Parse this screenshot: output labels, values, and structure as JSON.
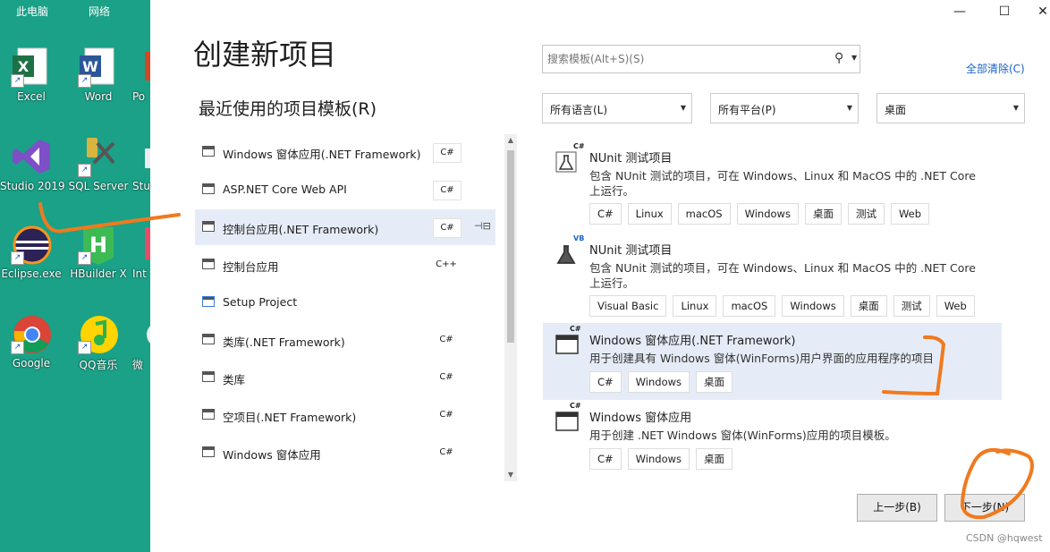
{
  "desktop": {
    "top_labels": [
      "此电脑",
      "网络"
    ],
    "icons": [
      {
        "label": "Excel",
        "icon": "excel-icon"
      },
      {
        "label": "Word",
        "icon": "word-icon"
      },
      {
        "label": "Po",
        "icon": "powerpoint-icon"
      },
      {
        "label": "Studio 2019",
        "icon": "visual-studio-icon"
      },
      {
        "label": "SQL Server",
        "icon": "sql-server-icon"
      },
      {
        "label": "Stu",
        "icon": "studio-icon"
      },
      {
        "label": "Eclipse.exe",
        "icon": "eclipse-icon"
      },
      {
        "label": "HBuilder X",
        "icon": "hbuilder-icon"
      },
      {
        "label": "Int",
        "icon": "intellij-icon"
      },
      {
        "label": "Google",
        "icon": "chrome-icon"
      },
      {
        "label": "QQ音乐",
        "icon": "qq-music-icon"
      },
      {
        "label": "微",
        "icon": "wechat-icon"
      }
    ]
  },
  "window_controls": {
    "minimize": "—",
    "maximize": "☐",
    "close": "✕"
  },
  "dialog": {
    "title": "创建新项目",
    "recent_title": "最近使用的项目模板(R)",
    "recent_items": [
      {
        "name": "Windows 窗体应用(.NET Framework)",
        "lang": "C#",
        "icon": "winforms-icon",
        "selected": false
      },
      {
        "name": "ASP.NET Core Web API",
        "lang": "C#",
        "icon": "web-api-icon",
        "selected": false
      },
      {
        "name": "控制台应用(.NET Framework)",
        "lang": "C#",
        "icon": "console-icon",
        "selected": true,
        "pinned": true
      },
      {
        "name": "控制台应用",
        "lang": "C++",
        "icon": "console-icon",
        "selected": false
      },
      {
        "name": "Setup Project",
        "lang": "",
        "icon": "setup-icon",
        "selected": false
      },
      {
        "name": "类库(.NET Framework)",
        "lang": "C#",
        "icon": "library-icon",
        "selected": false
      },
      {
        "name": "类库",
        "lang": "C#",
        "icon": "library-icon",
        "selected": false
      },
      {
        "name": "空项目(.NET Framework)",
        "lang": "C#",
        "icon": "empty-project-icon",
        "selected": false
      },
      {
        "name": "Windows 窗体应用",
        "lang": "C#",
        "icon": "winforms-icon",
        "selected": false
      }
    ],
    "search": {
      "placeholder": "搜索模板(Alt+S)(S)",
      "value": ""
    },
    "clear_all": "全部清除(C)",
    "filters": {
      "language": "所有语言(L)",
      "platform": "所有平台(P)",
      "project_type": "桌面"
    },
    "templates": [
      {
        "title": "NUnit 测试项目",
        "badge": "C#",
        "icon": "test-flask-icon",
        "description": "包含 NUnit 测试的项目，可在 Windows、Linux 和 MacOS 中的 .NET Core 上运行。",
        "tags": [
          "C#",
          "Linux",
          "macOS",
          "Windows",
          "桌面",
          "测试",
          "Web"
        ],
        "selected": false
      },
      {
        "title": "NUnit 测试项目",
        "badge": "VB",
        "icon": "test-flask-icon",
        "description": "包含 NUnit 测试的项目，可在 Windows、Linux 和 MacOS 中的 .NET Core 上运行。",
        "tags": [
          "Visual Basic",
          "Linux",
          "macOS",
          "Windows",
          "桌面",
          "测试",
          "Web"
        ],
        "selected": false
      },
      {
        "title": "Windows 窗体应用(.NET Framework)",
        "badge": "C#",
        "icon": "winforms-icon",
        "description": "用于创建具有 Windows 窗体(WinForms)用户界面的应用程序的项目",
        "tags": [
          "C#",
          "Windows",
          "桌面"
        ],
        "selected": true
      },
      {
        "title": "Windows 窗体应用",
        "badge": "C#",
        "icon": "winforms-icon",
        "description": "用于创建 .NET Windows 窗体(WinForms)应用的项目模板。",
        "tags": [
          "C#",
          "Windows",
          "桌面"
        ],
        "selected": false
      }
    ],
    "back_button": "上一步(B)",
    "next_button": "下一步(N)"
  },
  "watermark": "CSDN @hqwest",
  "colors": {
    "accent": "#1a64c8",
    "selection": "#e6ecf7",
    "desktop": "#1aa187",
    "annotation": "#f07a1e"
  }
}
